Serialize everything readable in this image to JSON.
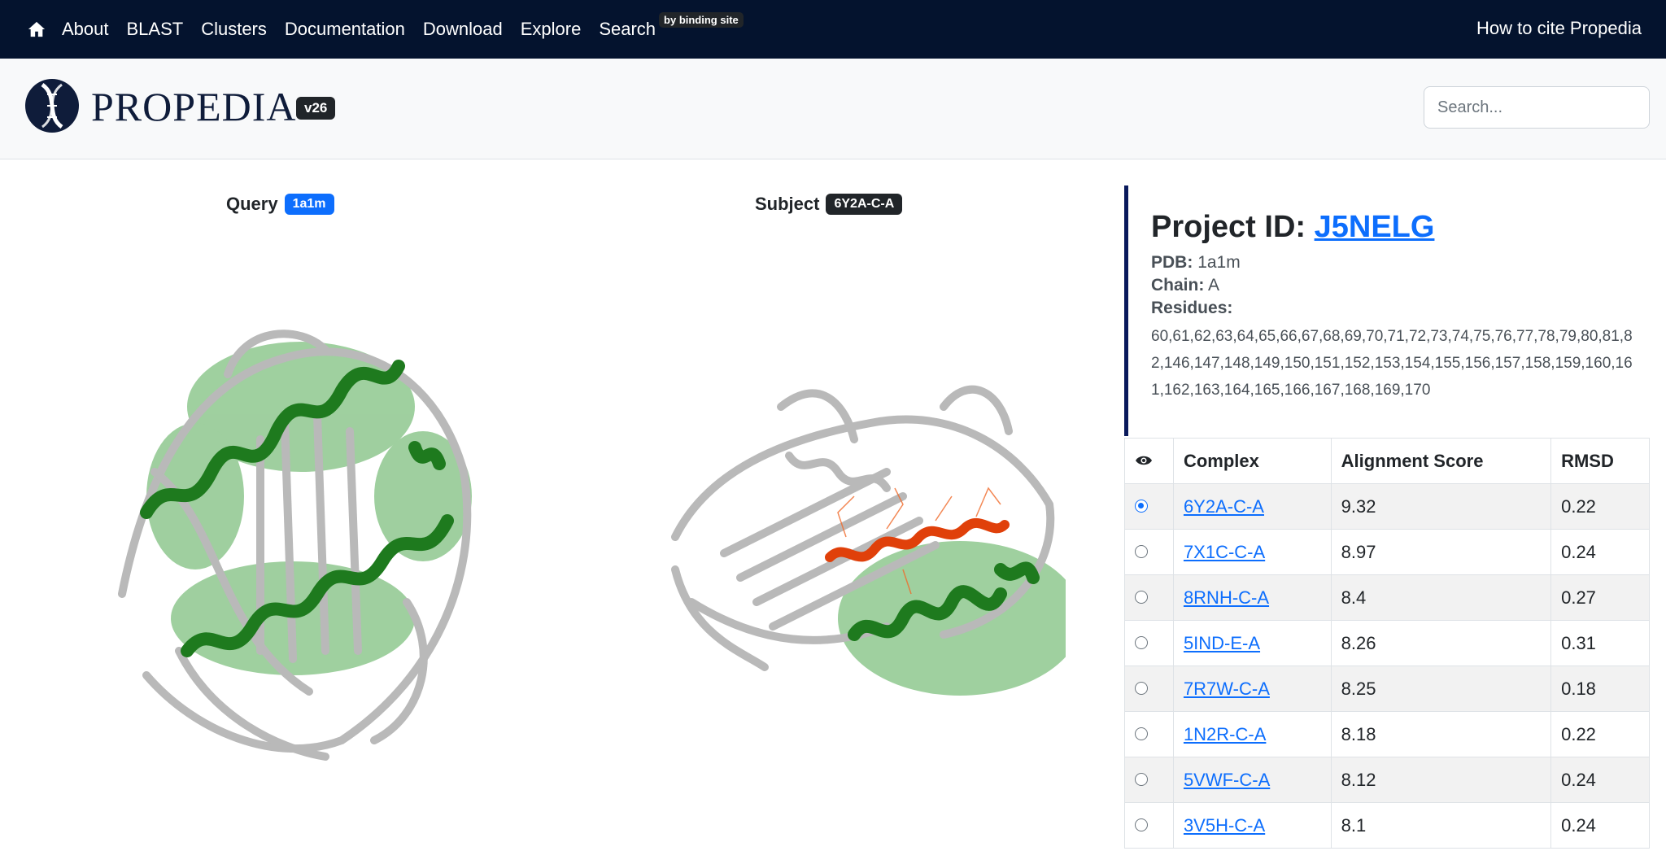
{
  "nav": {
    "home_icon": "home-icon",
    "items": [
      "About",
      "BLAST",
      "Clusters",
      "Documentation",
      "Download",
      "Explore"
    ],
    "search_label": "Search",
    "search_badge": "by binding site",
    "cite": "How to cite Propedia"
  },
  "header": {
    "logo_text": "PROPEDIA",
    "version": "v26",
    "search_placeholder": "Search..."
  },
  "query": {
    "label": "Query",
    "id": "1a1m"
  },
  "subject": {
    "label": "Subject",
    "id": "6Y2A-C-A"
  },
  "project": {
    "title_prefix": "Project ID: ",
    "id": "J5NELG",
    "pdb_label": "PDB:",
    "pdb": "1a1m",
    "chain_label": "Chain:",
    "chain": "A",
    "residues_label": "Residues:",
    "residues": "60,61,62,63,64,65,66,67,68,69,70,71,72,73,74,75,76,77,78,79,80,81,82,146,147,148,149,150,151,152,153,154,155,156,157,158,159,160,161,162,163,164,165,166,167,168,169,170"
  },
  "table": {
    "headers": {
      "eye_icon": "eye-icon",
      "complex": "Complex",
      "score": "Alignment Score",
      "rmsd": "RMSD"
    },
    "rows": [
      {
        "complex": "6Y2A-C-A",
        "score": "9.32",
        "rmsd": "0.22",
        "selected": true
      },
      {
        "complex": "7X1C-C-A",
        "score": "8.97",
        "rmsd": "0.24",
        "selected": false
      },
      {
        "complex": "8RNH-C-A",
        "score": "8.4",
        "rmsd": "0.27",
        "selected": false
      },
      {
        "complex": "5IND-E-A",
        "score": "8.26",
        "rmsd": "0.31",
        "selected": false
      },
      {
        "complex": "7R7W-C-A",
        "score": "8.25",
        "rmsd": "0.18",
        "selected": false
      },
      {
        "complex": "1N2R-C-A",
        "score": "8.18",
        "rmsd": "0.22",
        "selected": false
      },
      {
        "complex": "5VWF-C-A",
        "score": "8.12",
        "rmsd": "0.24",
        "selected": false
      },
      {
        "complex": "3V5H-C-A",
        "score": "8.1",
        "rmsd": "0.24",
        "selected": false
      }
    ]
  },
  "colors": {
    "navbar": "#04132e",
    "accent": "#0d6efd",
    "binding_site": "#1e7a1e",
    "peptide": "#e0400a"
  }
}
